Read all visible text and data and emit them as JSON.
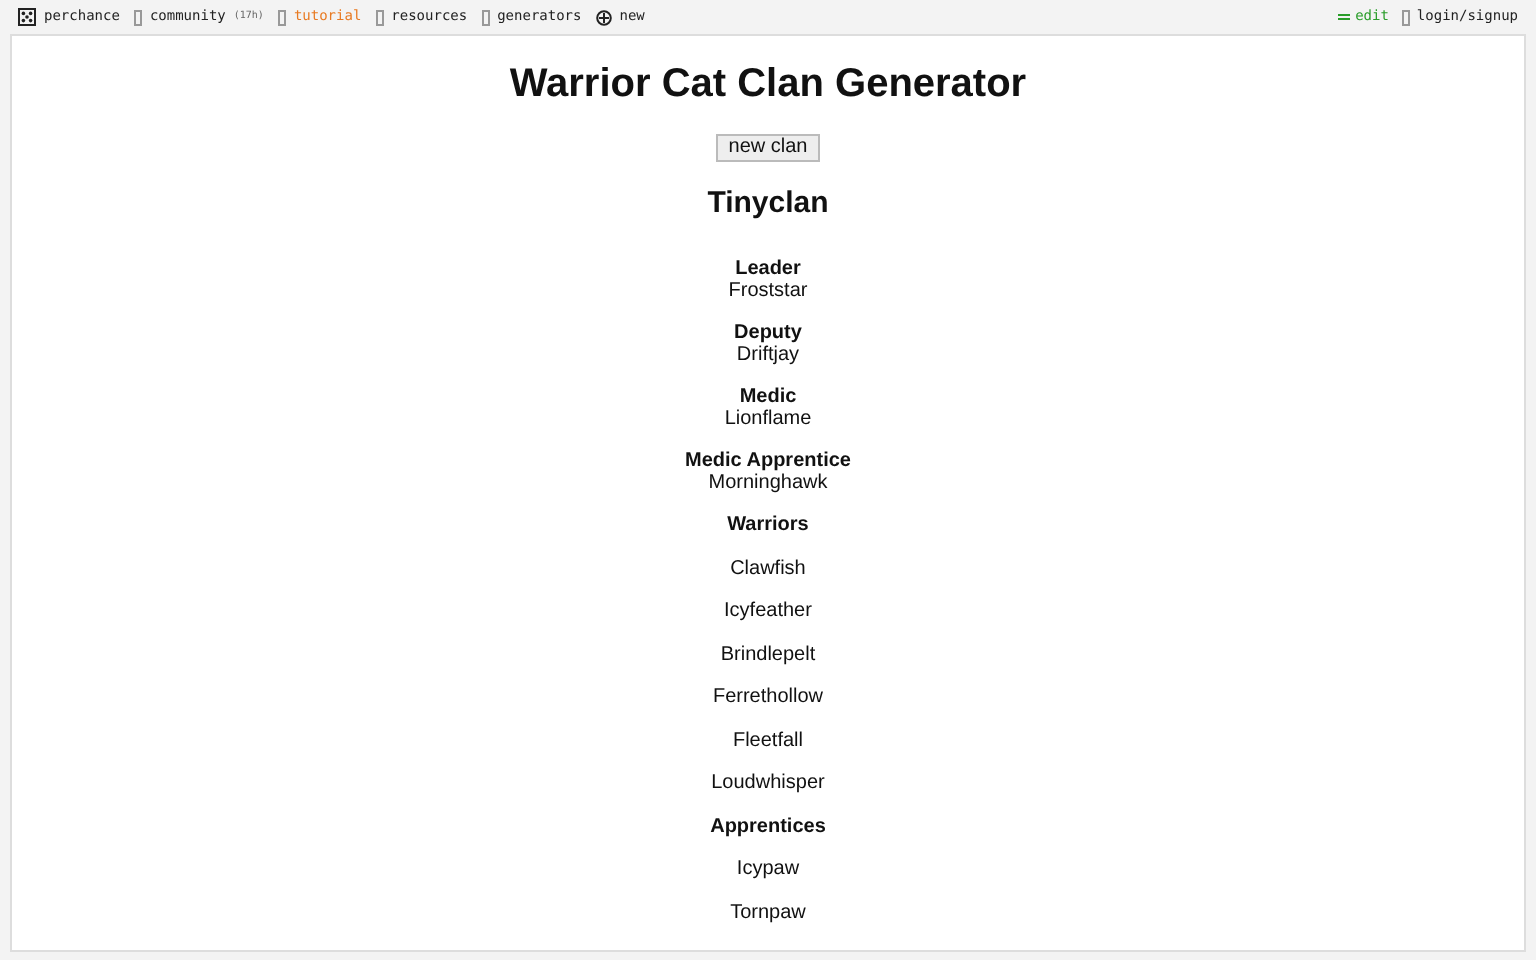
{
  "nav": {
    "left": [
      {
        "kind": "logo",
        "label": "perchance",
        "selected": false
      },
      {
        "kind": "box",
        "label": "community",
        "badge": "(17h)",
        "selected": false
      },
      {
        "kind": "box",
        "label": "tutorial",
        "selected": true
      },
      {
        "kind": "box",
        "label": "resources",
        "selected": false
      },
      {
        "kind": "box",
        "label": "generators",
        "selected": false
      },
      {
        "kind": "plus",
        "label": "new",
        "selected": false
      }
    ],
    "right": [
      {
        "kind": "edit",
        "label": "edit"
      },
      {
        "kind": "box",
        "label": "login/signup"
      }
    ]
  },
  "title": "Warrior Cat Clan Generator",
  "button": "new clan",
  "clan_name": "Tinyclan",
  "roles": [
    {
      "kind": "single",
      "heading": "Leader",
      "names": [
        "Froststar"
      ]
    },
    {
      "kind": "single",
      "heading": "Deputy",
      "names": [
        "Driftjay"
      ]
    },
    {
      "kind": "single",
      "heading": "Medic",
      "names": [
        "Lionflame"
      ]
    },
    {
      "kind": "single",
      "heading": "Medic Apprentice",
      "names": [
        "Morninghawk"
      ]
    },
    {
      "kind": "list",
      "heading": "Warriors",
      "names": [
        "Clawfish",
        "Icyfeather",
        "Brindlepelt",
        "Ferrethollow",
        "Fleetfall",
        "Loudwhisper"
      ]
    },
    {
      "kind": "list",
      "heading": "Apprentices",
      "names": [
        "Icypaw",
        "Tornpaw"
      ]
    }
  ]
}
